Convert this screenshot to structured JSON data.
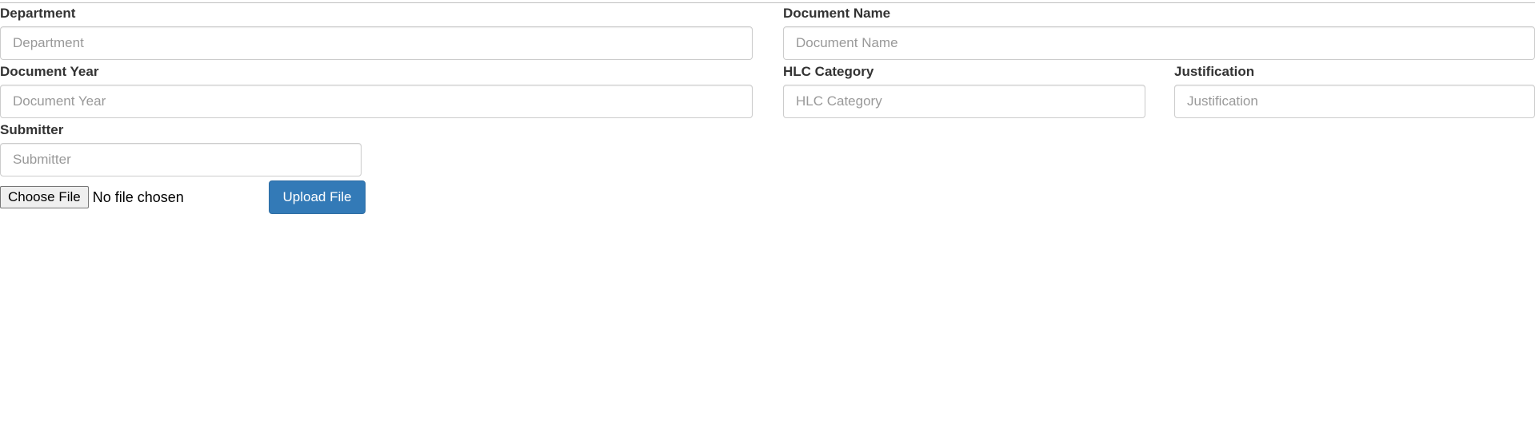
{
  "form": {
    "department": {
      "label": "Department",
      "placeholder": "Department",
      "value": ""
    },
    "document_name": {
      "label": "Document Name",
      "placeholder": "Document Name",
      "value": ""
    },
    "document_year": {
      "label": "Document Year",
      "placeholder": "Document Year",
      "value": ""
    },
    "hlc_category": {
      "label": "HLC Category",
      "placeholder": "HLC Category",
      "value": ""
    },
    "justification": {
      "label": "Justification",
      "placeholder": "Justification",
      "value": ""
    },
    "submitter": {
      "label": "Submitter",
      "placeholder": "Submitter",
      "value": ""
    }
  },
  "file_input": {
    "button_label": "Choose File",
    "status_text": "No file chosen"
  },
  "upload_button": {
    "label": "Upload File",
    "color": "#337ab7"
  }
}
